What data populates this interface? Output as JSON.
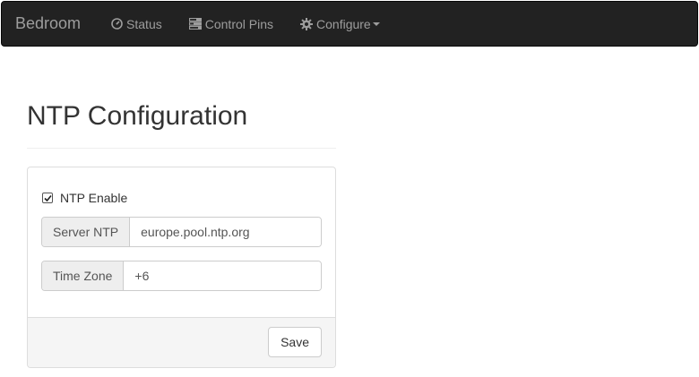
{
  "navbar": {
    "brand": "Bedroom",
    "items": [
      {
        "label": "Status",
        "icon": "dashboard-icon"
      },
      {
        "label": "Control Pins",
        "icon": "tasks-icon"
      },
      {
        "label": "Configure",
        "icon": "cog-icon",
        "dropdown": true
      }
    ]
  },
  "page": {
    "title": "NTP Configuration"
  },
  "form": {
    "ntp_enable": {
      "label": "NTP Enable",
      "checked": true
    },
    "server": {
      "label": "Server NTP",
      "value": "europe.pool.ntp.org"
    },
    "timezone": {
      "label": "Time Zone",
      "value": "+6"
    },
    "save_label": "Save"
  },
  "colors": {
    "navbar_bg": "#222222",
    "navbar_text": "#9d9d9d",
    "addon_bg": "#eeeeee",
    "footer_bg": "#f5f5f5"
  }
}
